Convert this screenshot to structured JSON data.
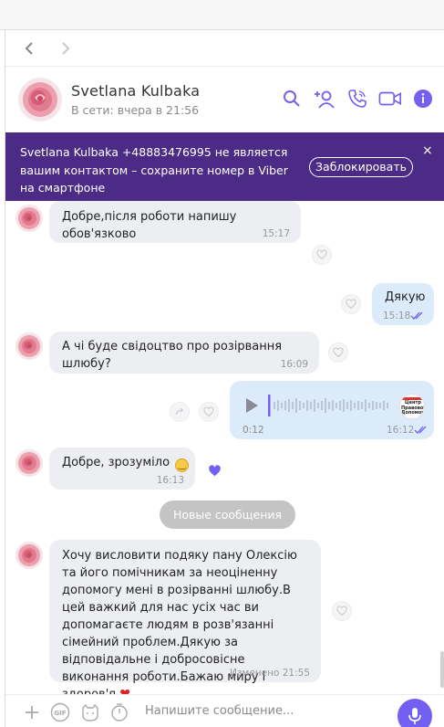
{
  "contact": {
    "name": "Svetlana Kulbaka",
    "status": "В сети: вчера в 21:56"
  },
  "banner": {
    "text": "Svetlana Kulbaka +48883476995 не является вашим контактом – сохраните номер в Viber на смартфоне",
    "block_label": "Заблокировать",
    "close_glyph": "×"
  },
  "messages": [
    {
      "direction": "in",
      "text": "Добре,після роботи напишу обов'язково",
      "time": "15:17"
    },
    {
      "direction": "out",
      "text": "Дякую",
      "time": "15:18"
    },
    {
      "direction": "in",
      "text": "А чі буде свідоцтво про розірвання шлюбу?",
      "time": "16:09"
    },
    {
      "direction": "out",
      "type": "voice",
      "duration": "0:12",
      "time": "16:12",
      "thumb_text": "Центр Правової Допомоги"
    },
    {
      "direction": "in",
      "text": "Добре, зрозуміло",
      "emoji": "🙂",
      "time": "16:13"
    },
    {
      "direction": "in",
      "text": "Хочу висловити подяку пану Олексію та його помічникам за неоціненну допомогу мені в розірванні шлюбу.В цей важкий для нас усіх час ви допомагаєте людям в розв'язанні сімейний проблем.Дякую за відповідальне і добросовісне виконання роботи.Бажаю миру і здоров'я",
      "emoji": "❤",
      "time": "Изменено 21:55"
    }
  ],
  "divider": {
    "label": "Новые сообщения"
  },
  "composer": {
    "placeholder": "Напишите сообщение..."
  },
  "colors": {
    "accent": "#7360f2",
    "banner": "#4b2b86",
    "bubble_in": "#eceef1",
    "bubble_out": "#dcebfa"
  },
  "icons": [
    "back-icon",
    "forward-icon",
    "search-icon",
    "add-contact-icon",
    "phone-icon",
    "video-icon",
    "info-icon",
    "heart-icon",
    "share-icon",
    "play-icon",
    "plus-icon",
    "gif-icon",
    "sticker-icon",
    "timer-icon",
    "mic-icon"
  ]
}
